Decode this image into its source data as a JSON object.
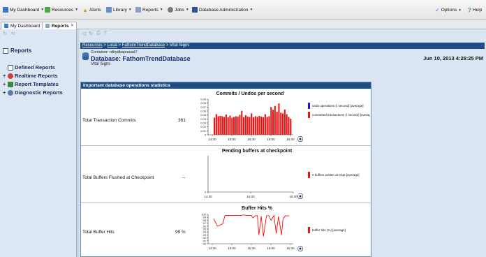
{
  "menubar": {
    "items": [
      {
        "label": "My Dashboard",
        "icon": "dashboard-icon"
      },
      {
        "label": "Resources",
        "icon": "resources-icon"
      },
      {
        "label": "Alerts",
        "icon": "alert-icon"
      },
      {
        "label": "Library",
        "icon": "library-icon"
      },
      {
        "label": "Reports",
        "icon": "reports-icon"
      },
      {
        "label": "Jobs",
        "icon": "jobs-icon"
      },
      {
        "label": "Database Administration",
        "icon": "database-icon"
      }
    ],
    "right_items": [
      {
        "label": "Options",
        "icon": "options-check-icon"
      },
      {
        "label": "Help",
        "icon": "help-icon"
      }
    ]
  },
  "tabs": [
    {
      "label": "My Dashboard",
      "active": false
    },
    {
      "label": "Reports",
      "active": true
    }
  ],
  "sidebar": {
    "title": "Reports",
    "items": [
      {
        "label": "Defined Reports",
        "expander": ""
      },
      {
        "label": "Realtime Reports",
        "expander": "+"
      },
      {
        "label": "Report Templates",
        "expander": "+"
      },
      {
        "label": "Diagnostic Reports",
        "expander": "+"
      }
    ]
  },
  "breadcrumb": {
    "resources": "Resources",
    "local": "Local",
    "database": "FathomTrendDatabase",
    "current": "Vital Signs",
    "sep": " > "
  },
  "header": {
    "container_label": "Container: rdhydbaprasad7",
    "database_prefix": "Database:",
    "database_name": "FathomTrendDatabase",
    "subtitle": "Vital Signs",
    "datetime": "Jun 10, 2013 4:28:25 PM"
  },
  "panel": {
    "title": "Important database operations statistics"
  },
  "metrics": [
    {
      "label": "Total Transaction Commits",
      "value": "361"
    },
    {
      "label": "Total Buffers Flushed at Checkpoint",
      "value": "--"
    },
    {
      "label": "Total Buffer Hits",
      "value": "99 %"
    }
  ],
  "chart_data": [
    {
      "type": "bar",
      "title": "Commits / Undos per second",
      "x_ticks": [
        "14:30",
        "15:00",
        "15:30",
        "16:00",
        "16:30"
      ],
      "y_ticks": [
        "0",
        "0.01",
        "0.02",
        "0.03",
        "0.04",
        "0.05",
        "0.06",
        "0.07",
        "0.08",
        "0.09"
      ],
      "ylim": [
        0,
        0.1
      ],
      "series": [
        {
          "name": "undo operations (/ second) [average]",
          "color": "#1a1aee",
          "values": []
        },
        {
          "name": "committed transactions (/ second) [average]",
          "color": "#ee1111",
          "values": [
            0.048,
            0.058,
            0.052,
            0.053,
            0.052,
            0.05,
            0.057,
            0.049,
            0.054,
            0.048,
            0.05,
            0.052,
            0.051,
            0.056,
            0.067,
            0.049,
            0.055,
            0.051,
            0.05,
            0.06,
            0.049,
            0.052,
            0.05,
            0.053,
            0.051,
            0.049,
            0.058,
            0.05,
            0.052,
            0.078,
            0.07,
            0.081,
            0.065,
            0.088,
            0.062,
            0.06,
            0.071,
            0.058,
            0.05,
            0.045
          ]
        }
      ]
    },
    {
      "type": "line",
      "title": "Pending buffers at checkpoint",
      "x_ticks": [
        "14:30",
        "15:30",
        "16:30"
      ],
      "y_ticks": [
        "0"
      ],
      "series": [
        {
          "name": "# buffers written at Ckpt [average]",
          "color": "#ee1111",
          "values": []
        }
      ]
    },
    {
      "type": "line",
      "title": "Buffer Hits %",
      "x_ticks": [
        "14:30",
        "15:00",
        "15:30",
        "16:00",
        "16:30"
      ],
      "y_ticks": [
        "90",
        "91",
        "92",
        "93",
        "94",
        "95",
        "96",
        "97",
        "98",
        "99",
        "100"
      ],
      "ylim": [
        90,
        100
      ],
      "series": [
        {
          "name": "buffer hits (%) [average]",
          "color": "#ee1111",
          "x": [
            0,
            0.02,
            0.05,
            0.08,
            0.12,
            0.15,
            0.2,
            0.25,
            0.3,
            0.35,
            0.4,
            0.45,
            0.5,
            0.52,
            0.55,
            0.58,
            0.6,
            0.63,
            0.66,
            0.7,
            0.73,
            0.76,
            0.8,
            0.83,
            0.86,
            0.9,
            0.92,
            0.95,
            1.0
          ],
          "values": [
            98.5,
            97.5,
            96.0,
            96.3,
            96.8,
            99.6,
            99.7,
            99.6,
            99.7,
            99.6,
            99.8,
            99.6,
            99.7,
            98.8,
            99.5,
            99.6,
            93.0,
            99.4,
            92.5,
            99.5,
            99.6,
            98.0,
            99.6,
            93.5,
            99.3,
            93.0,
            98.6,
            99.5,
            99.5
          ]
        }
      ]
    }
  ]
}
